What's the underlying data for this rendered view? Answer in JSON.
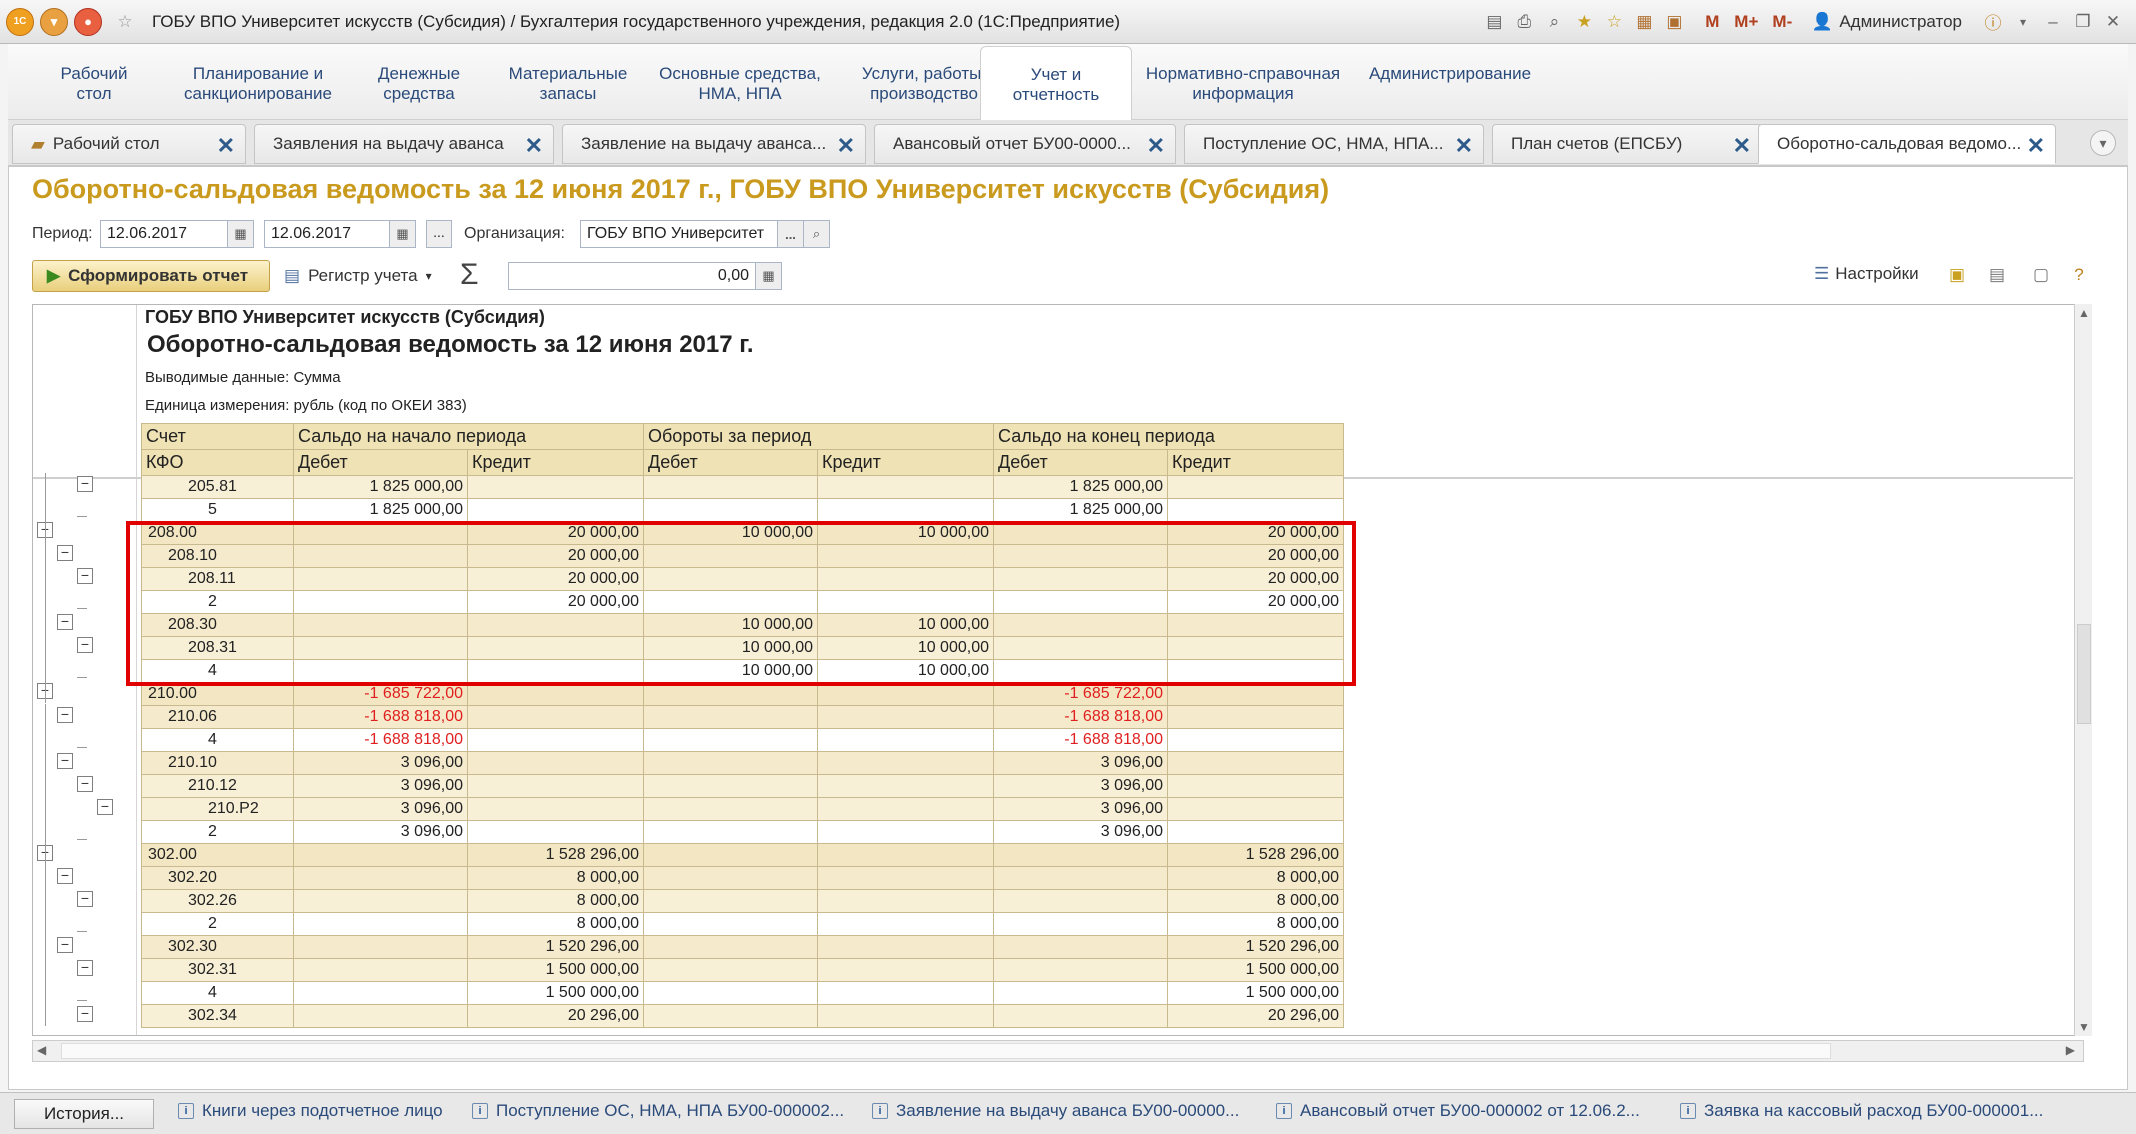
{
  "window": {
    "title": "ГОБУ ВПО Университет искусств (Субсидия) / Бухгалтерия государственного учреждения, редакция 2.0  (1С:Предприятие)",
    "logo": "1С",
    "toolbar_m": "M",
    "toolbar_mplus": "M+",
    "toolbar_mminus": "M-",
    "user": "Администратор"
  },
  "sections": [
    {
      "label": "Рабочий\nстол"
    },
    {
      "label": "Планирование и\nсанкционирование"
    },
    {
      "label": "Денежные\nсредства"
    },
    {
      "label": "Материальные\nзапасы"
    },
    {
      "label": "Основные средства,\nНМА, НПА"
    },
    {
      "label": "Услуги, работы,\nпроизводство"
    },
    {
      "label": "Учет и\nотчетность"
    },
    {
      "label": "Нормативно-справочная\nинформация"
    },
    {
      "label": "Администрирование"
    }
  ],
  "tabs": [
    {
      "label": "Рабочий стол"
    },
    {
      "label": "Заявления на выдачу аванса"
    },
    {
      "label": "Заявление на выдачу аванса..."
    },
    {
      "label": "Авансовый отчет БУ00-0000..."
    },
    {
      "label": "Поступление ОС, НМА, НПА..."
    },
    {
      "label": "План счетов (ЕПСБУ)"
    },
    {
      "label": "Оборотно-сальдовая ведомо..."
    }
  ],
  "report": {
    "title": "Оборотно-сальдовая ведомость за 12 июня 2017 г., ГОБУ ВПО Университет искусств (Субсидия)",
    "period_label": "Период:",
    "period_from": "12.06.2017",
    "period_to": "12.06.2017",
    "period_btn": "...",
    "org_label": "Организация:",
    "org_value": "ГОБУ ВПО Университет",
    "org_btn": "...",
    "generate_label": "Сформировать отчет",
    "register_label": "Регистр учета",
    "sum_value": "0,00",
    "settings_label": "Настройки"
  },
  "sheet": {
    "org": "ГОБУ ВПО Университет искусств (Субсидия)",
    "heading": "Оборотно-сальдовая ведомость за 12 июня 2017 г.",
    "output_label": "Выводимые данные:  Сумма",
    "unit_label": "Единица измерения: рубль (код по ОКЕИ 383)",
    "header1": [
      "Счет",
      "Сальдо на начало периода",
      "Обороты за период",
      "Сальдо на конец периода"
    ],
    "header2": [
      "КФО",
      "Дебет",
      "Кредит",
      "Дебет",
      "Кредит",
      "Дебет",
      "Кредит"
    ],
    "rows": [
      {
        "acc": "205.81",
        "lvl": 2,
        "v": [
          "1 825 000,00",
          "",
          "",
          "",
          "1 825 000,00",
          ""
        ]
      },
      {
        "acc": "5",
        "lvl": 4,
        "v": [
          "1 825 000,00",
          "",
          "",
          "",
          "1 825 000,00",
          ""
        ]
      },
      {
        "acc": "208.00",
        "lvl": 0,
        "v": [
          "",
          "20 000,00",
          "10 000,00",
          "10 000,00",
          "",
          "20 000,00"
        ]
      },
      {
        "acc": "208.10",
        "lvl": 1,
        "v": [
          "",
          "20 000,00",
          "",
          "",
          "",
          "20 000,00"
        ]
      },
      {
        "acc": "208.11",
        "lvl": 2,
        "v": [
          "",
          "20 000,00",
          "",
          "",
          "",
          "20 000,00"
        ]
      },
      {
        "acc": "2",
        "lvl": 4,
        "v": [
          "",
          "20 000,00",
          "",
          "",
          "",
          "20 000,00"
        ]
      },
      {
        "acc": "208.30",
        "lvl": 1,
        "v": [
          "",
          "",
          "10 000,00",
          "10 000,00",
          "",
          ""
        ]
      },
      {
        "acc": "208.31",
        "lvl": 2,
        "v": [
          "",
          "",
          "10 000,00",
          "10 000,00",
          "",
          ""
        ]
      },
      {
        "acc": "4",
        "lvl": 4,
        "v": [
          "",
          "",
          "10 000,00",
          "10 000,00",
          "",
          ""
        ]
      },
      {
        "acc": "210.00",
        "lvl": 0,
        "v": [
          "-1 685 722,00",
          "",
          "",
          "",
          "-1 685 722,00",
          ""
        ]
      },
      {
        "acc": "210.06",
        "lvl": 1,
        "v": [
          "-1 688 818,00",
          "",
          "",
          "",
          "-1 688 818,00",
          ""
        ]
      },
      {
        "acc": "4",
        "lvl": 4,
        "v": [
          "-1 688 818,00",
          "",
          "",
          "",
          "-1 688 818,00",
          ""
        ]
      },
      {
        "acc": "210.10",
        "lvl": 1,
        "v": [
          "3 096,00",
          "",
          "",
          "",
          "3 096,00",
          ""
        ]
      },
      {
        "acc": "210.12",
        "lvl": 2,
        "v": [
          "3 096,00",
          "",
          "",
          "",
          "3 096,00",
          ""
        ]
      },
      {
        "acc": "210.P2",
        "lvl": 3,
        "v": [
          "3 096,00",
          "",
          "",
          "",
          "3 096,00",
          ""
        ]
      },
      {
        "acc": "2",
        "lvl": 4,
        "v": [
          "3 096,00",
          "",
          "",
          "",
          "3 096,00",
          ""
        ]
      },
      {
        "acc": "302.00",
        "lvl": 0,
        "v": [
          "",
          "1 528 296,00",
          "",
          "",
          "",
          "1 528 296,00"
        ]
      },
      {
        "acc": "302.20",
        "lvl": 1,
        "v": [
          "",
          "8 000,00",
          "",
          "",
          "",
          "8 000,00"
        ]
      },
      {
        "acc": "302.26",
        "lvl": 2,
        "v": [
          "",
          "8 000,00",
          "",
          "",
          "",
          "8 000,00"
        ]
      },
      {
        "acc": "2",
        "lvl": 4,
        "v": [
          "",
          "8 000,00",
          "",
          "",
          "",
          "8 000,00"
        ]
      },
      {
        "acc": "302.30",
        "lvl": 1,
        "v": [
          "",
          "1 520 296,00",
          "",
          "",
          "",
          "1 520 296,00"
        ]
      },
      {
        "acc": "302.31",
        "lvl": 2,
        "v": [
          "",
          "1 500 000,00",
          "",
          "",
          "",
          "1 500 000,00"
        ]
      },
      {
        "acc": "4",
        "lvl": 4,
        "v": [
          "",
          "1 500 000,00",
          "",
          "",
          "",
          "1 500 000,00"
        ]
      },
      {
        "acc": "302.34",
        "lvl": 2,
        "v": [
          "",
          "20 296,00",
          "",
          "",
          "",
          "20 296,00"
        ]
      }
    ]
  },
  "history": {
    "button": "История...",
    "items": [
      "Книги через подотчетное лицо",
      "Поступление ОС, НМА, НПА БУ00-000002...",
      "Заявление на выдачу аванса БУ00-00000...",
      "Авансовый отчет БУ00-000002 от 12.06.2...",
      "Заявка на кассовый расход БУ00-000001..."
    ]
  }
}
